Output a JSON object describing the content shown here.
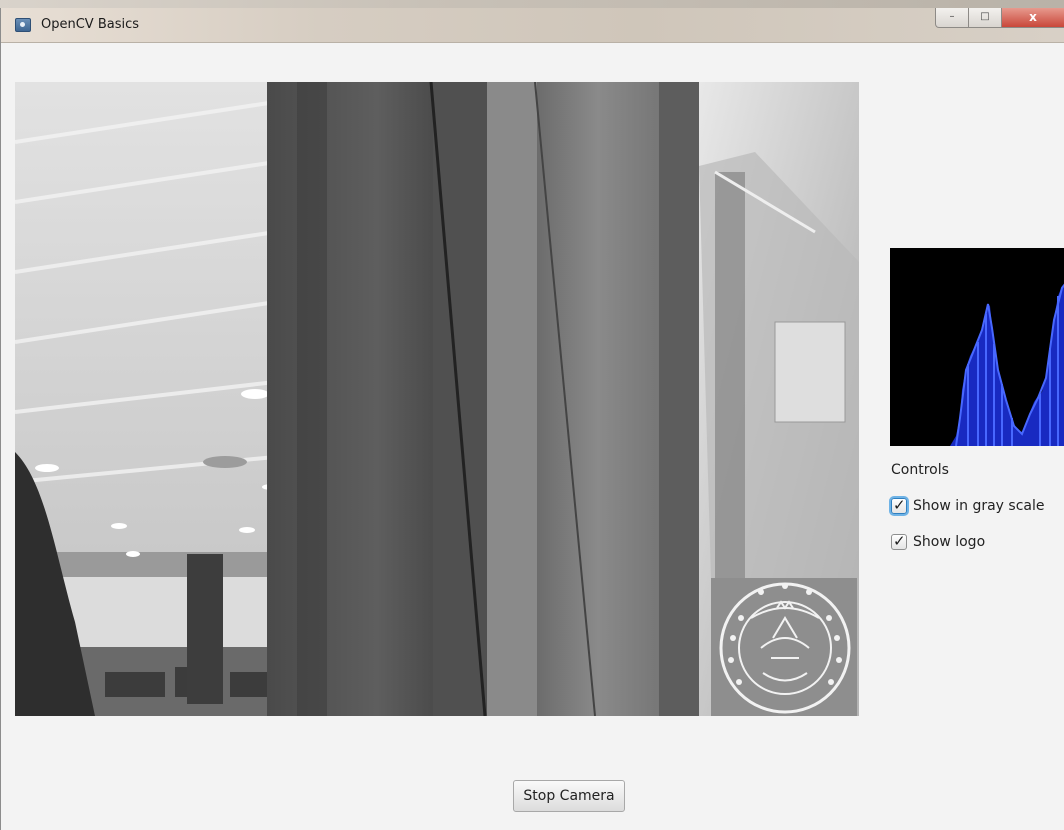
{
  "window": {
    "title": "OpenCV Basics",
    "controls": {
      "minimize": "–",
      "maximize": "□",
      "close": "x"
    }
  },
  "video": {
    "content": "camera-feed-grayscale"
  },
  "histogram": {
    "color": "#1f3cff",
    "background": "#000000"
  },
  "controls": {
    "title": "Controls",
    "gray_scale": {
      "label": "Show in gray scale",
      "checked": true
    },
    "show_logo": {
      "label": "Show logo",
      "checked": true
    }
  },
  "stop_button": {
    "label": "Stop Camera"
  }
}
